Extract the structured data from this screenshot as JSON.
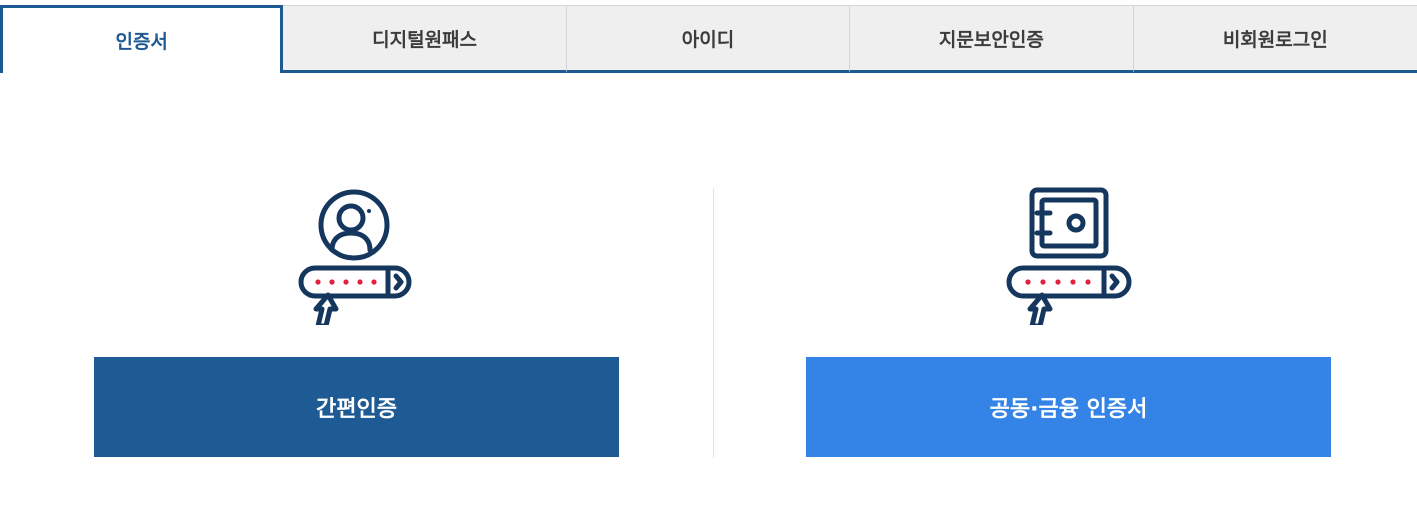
{
  "tabs": [
    {
      "label": "인증서",
      "active": true
    },
    {
      "label": "디지털원패스",
      "active": false
    },
    {
      "label": "아이디",
      "active": false
    },
    {
      "label": "지문보안인증",
      "active": false
    },
    {
      "label": "비회원로그인",
      "active": false
    }
  ],
  "options": {
    "simple_auth": {
      "label": "간편인증",
      "icon": "person-password-icon"
    },
    "certificate": {
      "label": "공동·금융 인증서",
      "icon": "safe-password-icon"
    }
  },
  "colors": {
    "primary": "#1e5a93",
    "accent": "#3483e6",
    "password_dot": "#e0223f"
  }
}
